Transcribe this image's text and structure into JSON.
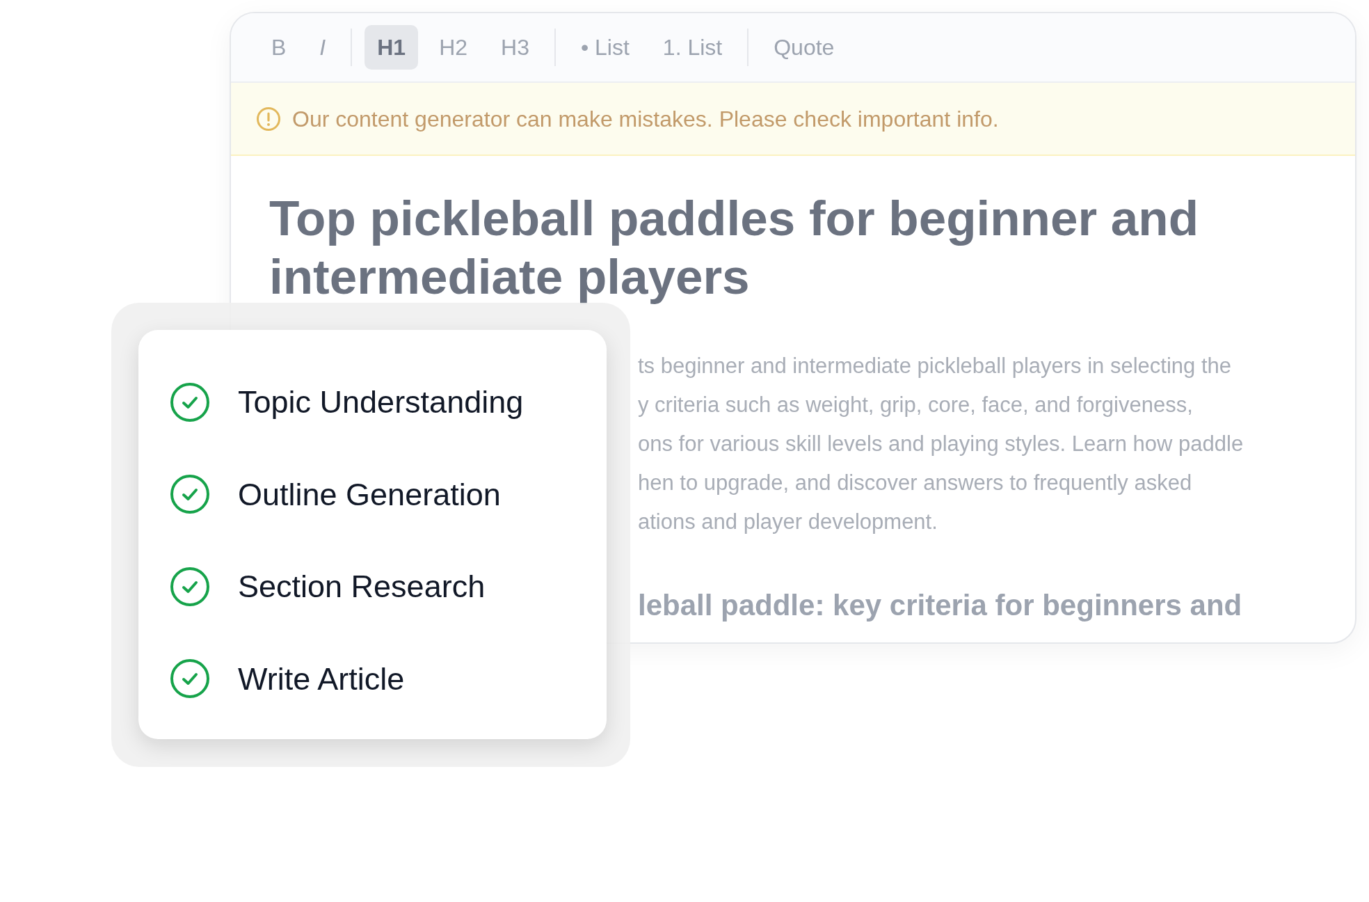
{
  "toolbar": {
    "groups": [
      [
        {
          "label": "B",
          "selected": false
        },
        {
          "label": "I",
          "selected": false
        }
      ],
      [
        {
          "label": "H1",
          "selected": true
        },
        {
          "label": "H2",
          "selected": false
        },
        {
          "label": "H3",
          "selected": false
        }
      ],
      [
        {
          "label": "• List",
          "selected": false
        },
        {
          "label": "1. List",
          "selected": false
        }
      ],
      [
        {
          "label": "Quote",
          "selected": false
        }
      ]
    ]
  },
  "notice": {
    "text": "Our content generator can make mistakes. Please check important info."
  },
  "document": {
    "title": "Top pickleball paddles for beginner and intermediate players",
    "paragraph_lines": [
      "ts beginner and intermediate pickleball players in selecting the",
      "y criteria such as weight, grip, core, face, and forgiveness,",
      "ons for various skill levels and playing styles. Learn how paddle",
      "hen to upgrade, and discover answers to frequently asked",
      "ations and player development."
    ],
    "subheading": "leball paddle: key criteria for beginners and"
  },
  "steps": [
    {
      "label": "Topic Understanding",
      "checked": true
    },
    {
      "label": "Outline Generation",
      "checked": true
    },
    {
      "label": "Section Research",
      "checked": true
    },
    {
      "label": "Write Article",
      "checked": true
    }
  ]
}
